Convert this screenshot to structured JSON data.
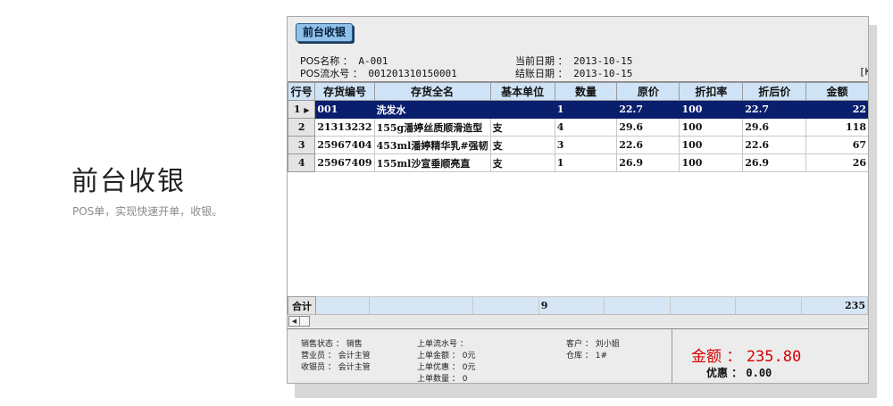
{
  "intro": {
    "title": "前台收银",
    "description": "POS单，实现快速开单，收银。"
  },
  "window": {
    "tab_label": "前台收银"
  },
  "info": {
    "pos_name_label": "POS名称 ：",
    "pos_name_value": "A-001",
    "pos_serial_label": "POS流水号 ：",
    "pos_serial_value": "001201310150001",
    "current_date_label": "当前日期 ：",
    "current_date_value": "2013-10-15",
    "settle_date_label": "结账日期 ：",
    "settle_date_value": "2013-10-15",
    "right_marker": "[K"
  },
  "table": {
    "headers": [
      "行号",
      "存货编号",
      "存货全名",
      "基本单位",
      "数量",
      "原价",
      "折扣率",
      "折后价",
      "金额"
    ],
    "rows": [
      {
        "no": "1",
        "code": "001",
        "name": "洗发水",
        "unit": "",
        "qty": "1",
        "price": "22.7",
        "discount_rate": "100",
        "discounted_price": "22.7",
        "amount": "22"
      },
      {
        "no": "2",
        "code": "21313232",
        "name": "155g潘婷丝质顺滑造型",
        "unit": "支",
        "qty": "4",
        "price": "29.6",
        "discount_rate": "100",
        "discounted_price": "29.6",
        "amount": "118"
      },
      {
        "no": "3",
        "code": "25967404",
        "name": "453ml潘婷精华乳#强韧",
        "unit": "支",
        "qty": "3",
        "price": "22.6",
        "discount_rate": "100",
        "discounted_price": "22.6",
        "amount": "67"
      },
      {
        "no": "4",
        "code": "25967409",
        "name": "155ml沙宣垂顺亮直",
        "unit": "支",
        "qty": "1",
        "price": "26.9",
        "discount_rate": "100",
        "discounted_price": "26.9",
        "amount": "26"
      }
    ],
    "selected_row_marker": "▶",
    "totals": {
      "label": "合计",
      "qty": "9",
      "amount": "235"
    }
  },
  "footer": {
    "sales_status": "销售状态 ： 销售",
    "salesperson": "营业员 ： 会计主管",
    "cashier": "收银员 ： 会计主管",
    "last_serial": "上单流水号 ：",
    "last_amount": "上单金额 ： 0元",
    "last_discount": "上单优惠 ： 0元",
    "last_qty": "上单数量 ： 0",
    "customer": "客户 ： 刘小姐",
    "warehouse": "仓库 ： 1#",
    "amount_label": "金额 ：",
    "amount_value": "235.80",
    "discount_label": "优惠 ：",
    "discount_value": "0.00"
  },
  "colors": {
    "selected_row": "#0a1e6e",
    "header_bg": "#cfe3f6",
    "amount_red": "#d40000",
    "tab_button": "#8fc2ea"
  }
}
